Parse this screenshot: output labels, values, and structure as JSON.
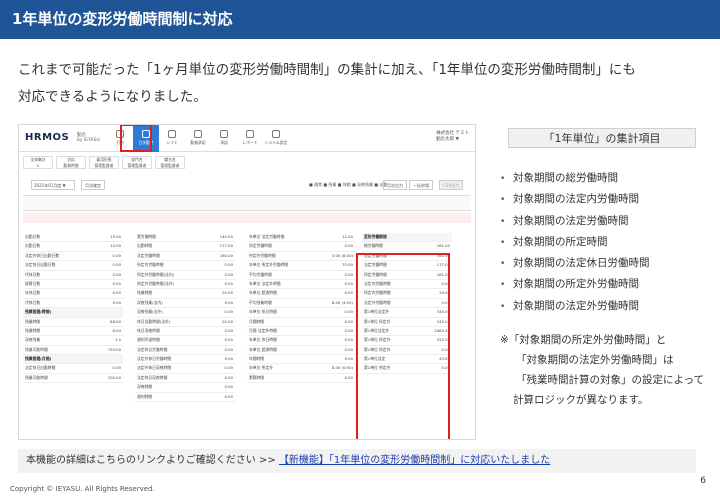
{
  "title": "1年単位の変形労働時間制に対応",
  "intro": {
    "line1": "これまで可能だった「1ヶ月単位の変形労働時間制」の集計に加え、「1年単位の変形労働時間制」にも",
    "line2": "対応できるようになりました。"
  },
  "screenshot": {
    "logo": "HRMOS",
    "logo_sub": [
      "勤怠",
      "by IEYASU"
    ],
    "nav": [
      "打刻",
      "日次勤怠",
      "シフト",
      "勤務承認",
      "承認",
      "レポート",
      "システム設定"
    ],
    "active_nav": 1,
    "user": [
      "株式会社 テスト",
      "勤怠太郎 ▼"
    ],
    "filters": [
      [
        "全体集計",
        "0"
      ],
      [
        "対応",
        "勤務時間"
      ],
      [
        "雇用形態",
        "管理監督者"
      ],
      [
        "部門名",
        "管理監督者"
      ],
      [
        "職名名",
        "管理監督者"
      ]
    ],
    "period": "2021年01月度 ▼",
    "period_btn": "月次確定",
    "legend": "■ 通常 ■ 残業 ■ 休暇 ■ 深夜残業 ■ 出勤",
    "buttons": [
      "月次出力",
      "一括申請",
      "CSV出力"
    ],
    "col1": [
      [
        "出勤日数",
        "13.00"
      ],
      [
        "欠勤日数",
        "14.00"
      ],
      [
        "法定外休日出勤日数",
        "0.00"
      ],
      [
        "法定休日出勤日数",
        "0.00"
      ],
      [
        "代休日数",
        "0.00"
      ],
      [
        "振替日数",
        "0.00"
      ],
      [
        "年休日数",
        "0.00"
      ],
      [
        "代休日数",
        "0.00"
      ],
      [
        "残業管理(時間)",
        ""
      ],
      [
        "残業時間",
        "88:00"
      ],
      [
        "残業時間",
        "6:40"
      ],
      [
        "深夜残業",
        "1.0"
      ],
      [
        "残業可能時間",
        "720:00"
      ],
      [
        "残業管理(月間)",
        ""
      ],
      [
        "法定休日出勤時間",
        "0.00"
      ],
      [
        "残業可能時間",
        "100.00"
      ]
    ],
    "col2": [
      [
        "実労働時間",
        "140.00"
      ],
      [
        "出勤時間",
        "177.00"
      ],
      [
        "法定労働時間",
        "160.00"
      ],
      [
        "所定内労働時間",
        "0.00"
      ],
      [
        "所定外労働時間(法内)",
        "0.00"
      ],
      [
        "所定外労働時間(法外)",
        "0.00"
      ],
      [
        "残業時間",
        "20.00"
      ],
      [
        "深夜残業(法内)",
        "0.00"
      ],
      [
        "深夜残業(法外)",
        "0.00"
      ],
      [
        "休日出勤時間(法外)",
        "20.00"
      ],
      [
        "休日深夜時間",
        "0.00"
      ],
      [
        "遅刻早退時間",
        "0.00"
      ],
      [
        "法定休日労働時間",
        "0.00"
      ],
      [
        "法定外休日労働時間",
        "0.00"
      ],
      [
        "法定外休日深夜時間",
        "0.00"
      ],
      [
        "法定休日深夜時間",
        "0.00"
      ],
      [
        "深夜時間",
        "0.00"
      ],
      [
        "遅刻時間",
        "0.00"
      ]
    ],
    "col3": [
      [
        "年単位 法定労働時間",
        "12.00"
      ],
      [
        "所定労働時間",
        "0.00"
      ],
      [
        "所定外労働時間",
        "3.00 (8:00)"
      ],
      [
        "年単位 所定外労働時間",
        "70.00"
      ],
      [
        "平均労働時間",
        "0.00"
      ],
      [
        "年単位 法定外時間",
        "0.00"
      ],
      [
        "年単位 超過時間",
        "0.00"
      ],
      [
        "平均残業時間",
        "8.00 (4:00)"
      ],
      [
        "年単位 休日時間",
        "0.00"
      ],
      [
        "月間時間",
        "0.00"
      ],
      [
        "月間 法定外時間",
        "0.00"
      ],
      [
        "年単位 休日時間",
        "0.00"
      ],
      [
        "年単位 超過時間",
        "0.00"
      ],
      [
        "年間時間",
        "0.00"
      ],
      [
        "年単位 所定外",
        "8.00 (0:00)"
      ],
      [
        "累積時間",
        "0.00"
      ]
    ],
    "col4": [
      [
        "変形労働期間",
        ""
      ],
      [
        "総労働時間",
        "161.00"
      ],
      [
        "法定労働時間",
        "161.00"
      ],
      [
        "法定労働時間",
        "177.00"
      ],
      [
        "所定労働時間",
        "181.00"
      ],
      [
        "法定内労働時間",
        "0.00"
      ],
      [
        "所定内労働時間",
        "29.00"
      ],
      [
        "法定外労働時間",
        "0.00"
      ],
      [
        "第1単位法定外",
        "345.00"
      ],
      [
        "第1単位 所定外",
        "345.00"
      ],
      [
        "第1単位法定外",
        "2083.42"
      ],
      [
        "第1単位 所定外",
        "322.00"
      ],
      [
        "第1単位 所定外",
        "0.00"
      ],
      [
        "第1単位法定",
        "43.00"
      ],
      [
        "第1単位 所定外",
        "0.00"
      ]
    ]
  },
  "panel": {
    "pill": "「1年単位」の集計項目",
    "items": [
      "対象期間の総労働時間",
      "対象期間の法定内労働時間",
      "対象期間の法定労働時間",
      "対象期間の所定時間",
      "対象期間の法定休日労働時間",
      "対象期間の所定外労働時間",
      "対象期間の法定外労働時間"
    ],
    "note": [
      "※「対象期間の所定外労働時間」と",
      "「対象期間の法定外労働時間」は",
      "「残業時間計算の対象」の設定によって",
      "計算ロジックが異なります。"
    ]
  },
  "footer": {
    "text": "本機能の詳細はこちらのリンクよりご確認ください >> ",
    "link": "【新機能】「1年単位の変形労働時間制」に対応いたしました"
  },
  "copyright": "Copyright © IEYASU. All Rights Reserved.",
  "page_number": "6"
}
